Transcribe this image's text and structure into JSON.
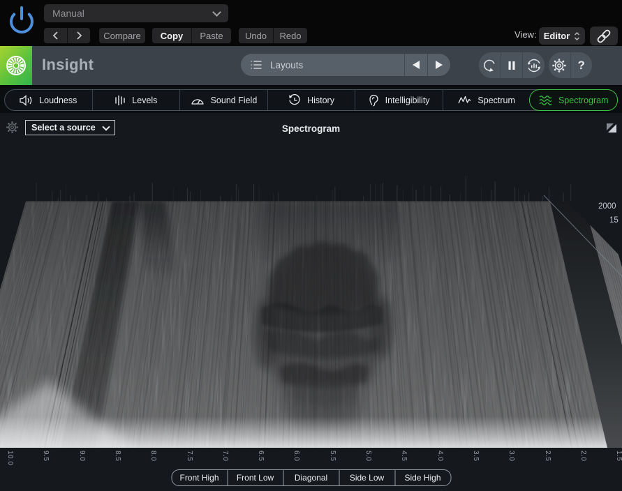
{
  "chrome": {
    "preset": {
      "value": "Manual"
    },
    "compare_label": "Compare",
    "copy_label": "Copy",
    "paste_label": "Paste",
    "undo_label": "Undo",
    "redo_label": "Redo",
    "view_label": "View:",
    "view_value": "Editor"
  },
  "header": {
    "app_name": "Insight",
    "layouts_label": "Layouts",
    "help_label": "?"
  },
  "tabs": [
    {
      "label": "Loudness",
      "icon": "speaker-icon",
      "active": false
    },
    {
      "label": "Levels",
      "icon": "meter-bars-icon",
      "active": false
    },
    {
      "label": "Sound Field",
      "icon": "gauge-icon",
      "active": false
    },
    {
      "label": "History",
      "icon": "history-clock-icon",
      "active": false
    },
    {
      "label": "Intelligibility",
      "icon": "ear-icon",
      "active": false
    },
    {
      "label": "Spectrum",
      "icon": "waveform-icon",
      "active": false
    },
    {
      "label": "Spectrogram",
      "icon": "waves-icon",
      "active": true
    }
  ],
  "panel": {
    "title": "Spectrogram",
    "source_select_value": "Select a source",
    "freq_axis_labels": [
      "2000",
      "15"
    ],
    "time_axis_labels": [
      "10.0",
      "9.5",
      "9.0",
      "8.5",
      "8.0",
      "7.5",
      "7.0",
      "6.5",
      "6.0",
      "5.5",
      "5.0",
      "4.5",
      "4.0",
      "3.5",
      "3.0",
      "2.5",
      "2.0",
      "1.5"
    ],
    "view_buttons": [
      "Front High",
      "Front Low",
      "Diagonal",
      "Side Low",
      "Side High"
    ]
  },
  "colors": {
    "accent_green": "#3ac144",
    "power_blue": "#4e8fdc",
    "logo_top": "#a9d22f",
    "logo_bottom": "#2fb44d"
  }
}
